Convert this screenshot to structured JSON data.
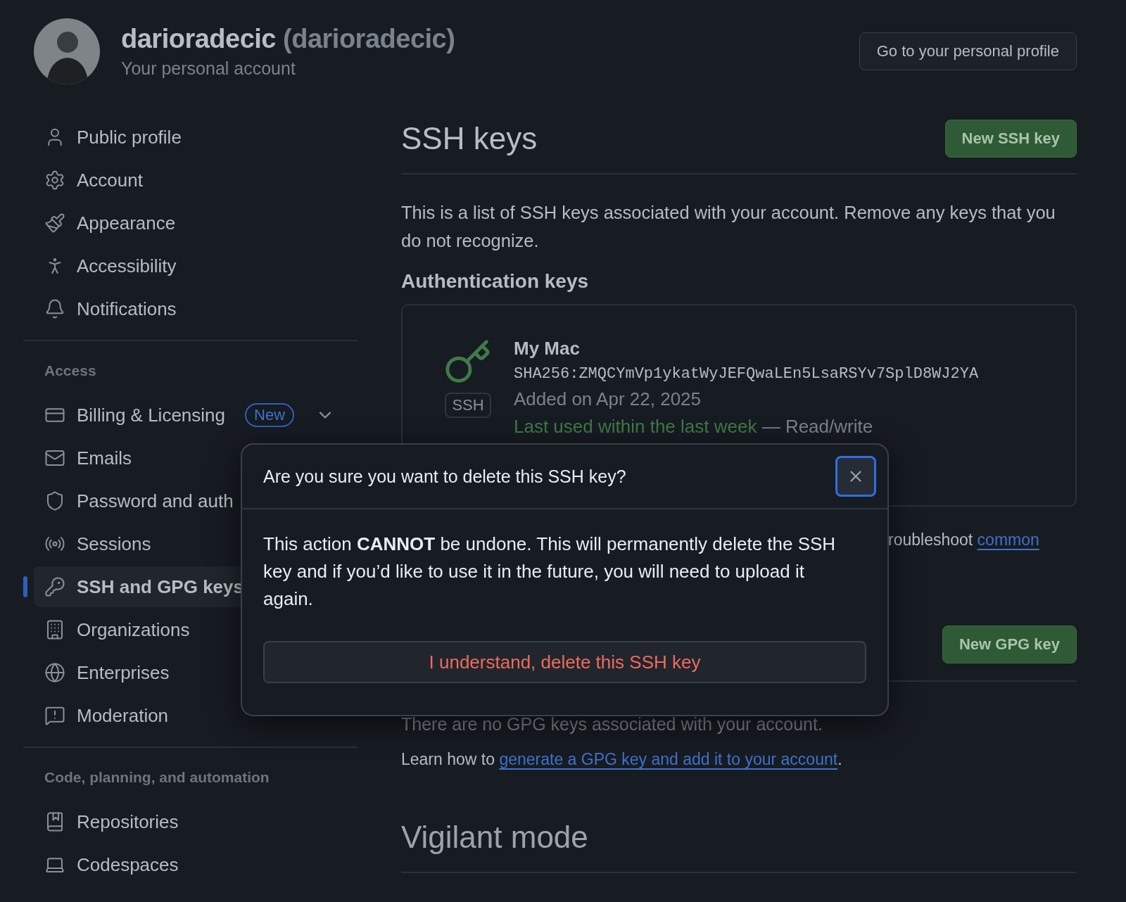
{
  "profile": {
    "name": "darioradecic",
    "handle": "(darioradecic)",
    "subtitle": "Your personal account",
    "button": "Go to your personal profile"
  },
  "sidebar": {
    "groups": [
      {
        "items": [
          {
            "label": "Public profile",
            "selected": false
          },
          {
            "label": "Account",
            "selected": false
          },
          {
            "label": "Appearance",
            "selected": false
          },
          {
            "label": "Accessibility",
            "selected": false
          },
          {
            "label": "Notifications",
            "selected": false
          }
        ]
      },
      {
        "heading": "Access",
        "items": [
          {
            "label": "Billing & Licensing",
            "selected": false,
            "badge": "New",
            "expanded": false
          },
          {
            "label": "Emails",
            "selected": false
          },
          {
            "label": "Password and auth",
            "selected": false
          },
          {
            "label": "Sessions",
            "selected": false
          },
          {
            "label": "SSH and GPG keys",
            "selected": true
          },
          {
            "label": "Organizations",
            "selected": false
          },
          {
            "label": "Enterprises",
            "selected": false
          },
          {
            "label": "Moderation",
            "selected": false
          }
        ]
      },
      {
        "heading": "Code, planning, and automation",
        "items": [
          {
            "label": "Repositories",
            "selected": false
          },
          {
            "label": "Codespaces",
            "selected": false
          }
        ]
      }
    ]
  },
  "main": {
    "title": "SSH keys",
    "new_button": "New SSH key",
    "intro": "This is a list of SSH keys associated with your account. Remove any keys that you do not recognize.",
    "auth_heading": "Authentication keys",
    "keys": [
      {
        "name": "My Mac",
        "fingerprint": "SHA256:ZMQCYmVp1ykatWyJEFQwaLEn5LsaRSYv7SplD8WJ2YA",
        "added": "Added on Apr 22, 2025",
        "last_used": "Last used within the last week",
        "access": "— Read/write",
        "type_badge": "SSH"
      }
    ],
    "help_text": "roubleshoot",
    "help_link": "common",
    "gpg": {
      "new_button": "New GPG key",
      "empty": "There are no GPG keys associated with your account.",
      "learn_prefix": "Learn how to ",
      "learn_link": "generate a GPG key and add it to your account",
      "learn_suffix": "."
    },
    "vigilant_title": "Vigilant mode"
  },
  "dialog": {
    "title": "Are you sure you want to delete this SSH key?",
    "body": "This action **CANNOT** be undone. This will permanently delete the SSH key and if you’d like to use it in the future, you will need to upload it again.",
    "confirm": "I understand, delete this SSH key"
  }
}
